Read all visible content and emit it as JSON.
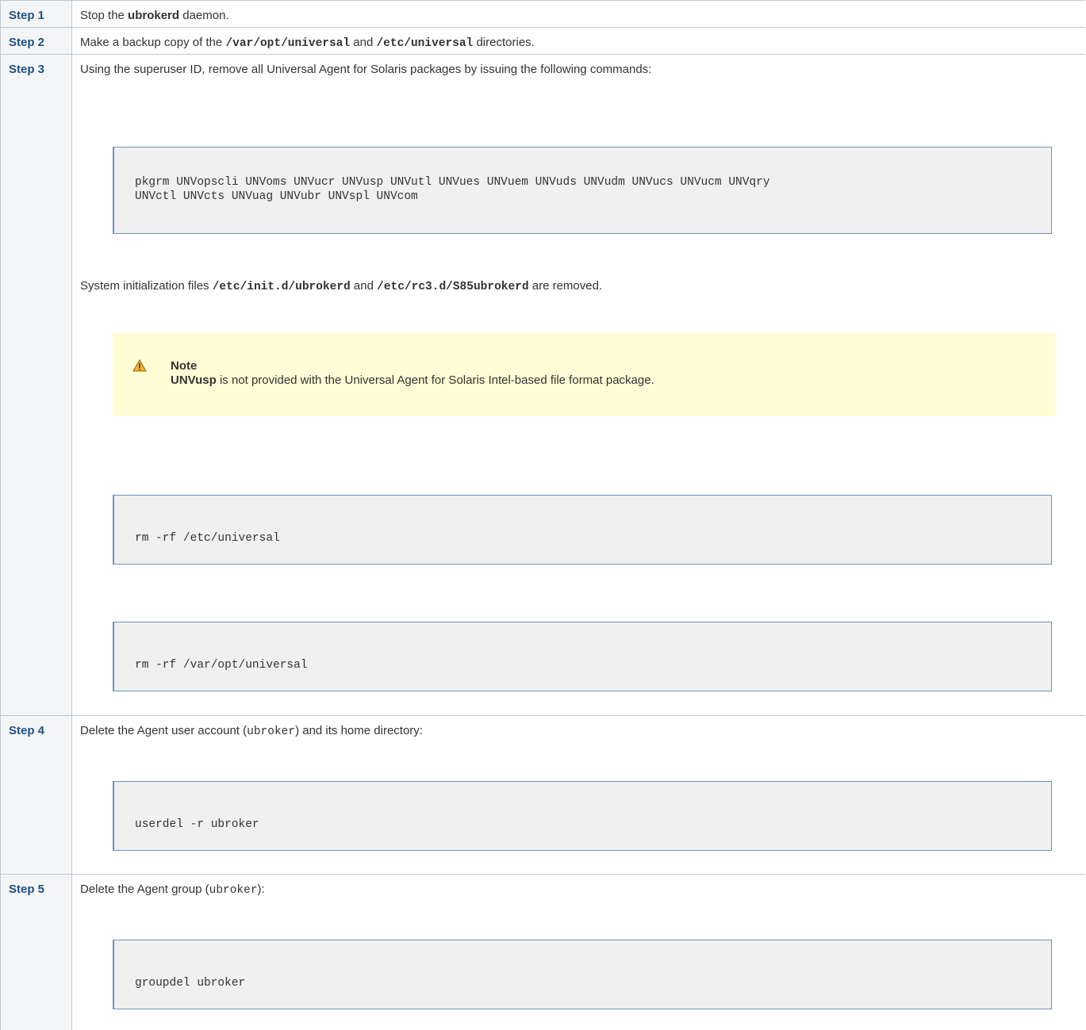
{
  "steps": [
    {
      "label": "Step 1",
      "text": {
        "pre": "Stop the ",
        "bold": "ubrokerd",
        "post": " daemon."
      }
    },
    {
      "label": "Step 2",
      "text": {
        "pre": "Make a backup copy of the ",
        "code1": "/var/opt/universal",
        "mid": " and ",
        "code2": "/etc/universal",
        "post": " directories."
      }
    },
    {
      "label": "Step 3",
      "intro": "Using the superuser ID, remove all Universal Agent for Solaris packages by issuing the following commands:",
      "code_pkgrm": "pkgrm UNVopscli UNVoms UNVucr UNVusp UNVutl UNVues UNVuem UNVuds UNVudm UNVucs UNVucm UNVqry\nUNVctl UNVcts UNVuag UNVubr UNVspl UNVcom",
      "removed": {
        "pre": "System initialization files ",
        "code1": "/etc/init.d/ubrokerd",
        "mid": " and ",
        "code2": "/etc/rc3.d/S85ubrokerd",
        "post": " are removed."
      },
      "note": {
        "icon": "warning-icon",
        "title": "Note",
        "bold": "UNVusp",
        "text": " is not provided with the Universal Agent for Solaris Intel-based file format package."
      },
      "code_rm_etc": "rm -rf /etc/universal",
      "code_rm_var": "rm -rf /var/opt/universal"
    },
    {
      "label": "Step 4",
      "text": {
        "pre": "Delete the Agent user account (",
        "code": "ubroker",
        "post": ") and its home directory:"
      },
      "code_cmd": "userdel -r ubroker"
    },
    {
      "label": "Step 5",
      "text": {
        "pre": "Delete the Agent group (",
        "code": "ubroker",
        "post": "):"
      },
      "code_cmd": "groupdel ubroker"
    }
  ],
  "colors": {
    "step_label": "#205081",
    "step_cell_bg": "#f4f5f7",
    "code_bg": "#f0f0f0",
    "code_border": "#6c94c6",
    "note_bg": "#fffdd6",
    "warning": "#f0b429"
  }
}
